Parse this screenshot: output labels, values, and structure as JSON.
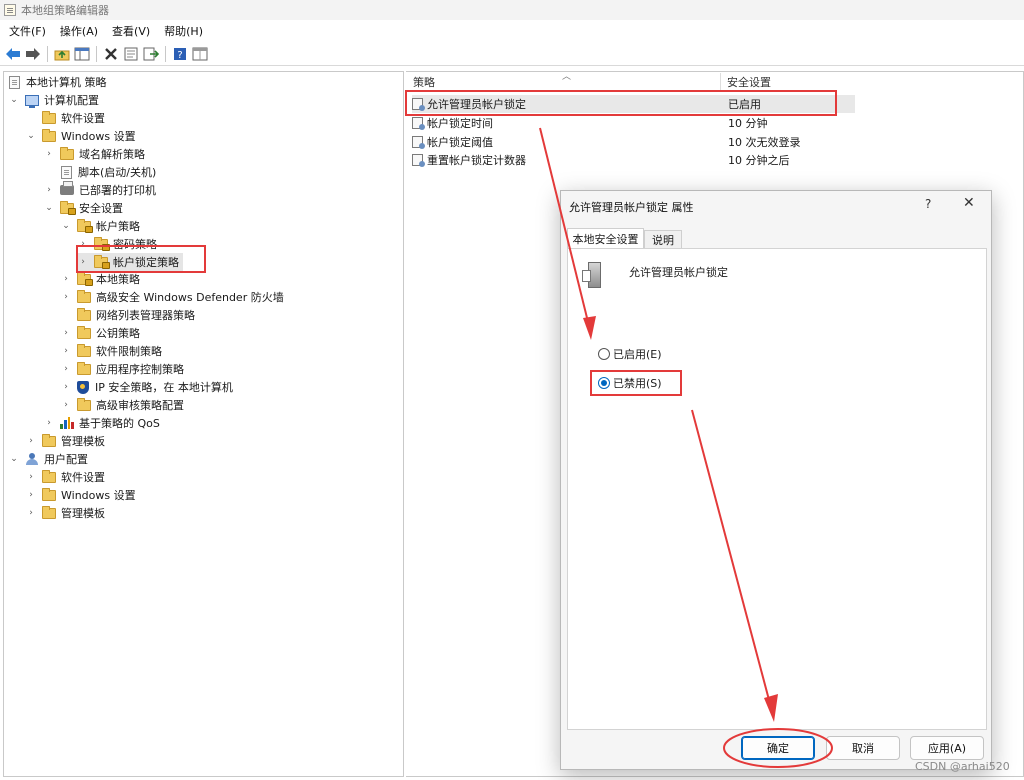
{
  "window": {
    "title": "本地组策略编辑器"
  },
  "menu": [
    "文件(F)",
    "操作(A)",
    "查看(V)",
    "帮助(H)"
  ],
  "toolbar": {
    "buttons": [
      "back-arrow-icon",
      "forward-arrow-icon",
      "up-folder-icon",
      "show-tree-icon",
      "delete-icon",
      "properties-icon",
      "export-icon",
      "help-icon",
      "view-icon"
    ]
  },
  "tree": {
    "items": [
      {
        "label": "本地计算机 策略"
      },
      {
        "label": "计算机配置"
      },
      {
        "label": "软件设置"
      },
      {
        "label": "Windows 设置"
      },
      {
        "label": "域名解析策略"
      },
      {
        "label": "脚本(启动/关机)"
      },
      {
        "label": "已部署的打印机"
      },
      {
        "label": "安全设置"
      },
      {
        "label": "帐户策略"
      },
      {
        "label": "密码策略"
      },
      {
        "label": "帐户锁定策略"
      },
      {
        "label": "本地策略"
      },
      {
        "label": "高级安全 Windows Defender 防火墙"
      },
      {
        "label": "网络列表管理器策略"
      },
      {
        "label": "公钥策略"
      },
      {
        "label": "软件限制策略"
      },
      {
        "label": "应用程序控制策略"
      },
      {
        "label": "IP 安全策略，在 本地计算机"
      },
      {
        "label": "高级审核策略配置"
      },
      {
        "label": "基于策略的 QoS"
      },
      {
        "label": "管理模板"
      },
      {
        "label": "用户配置"
      },
      {
        "label": "软件设置"
      },
      {
        "label": "Windows 设置"
      },
      {
        "label": "管理模板"
      }
    ]
  },
  "list": {
    "columns": {
      "policy": "策略",
      "setting": "安全设置"
    },
    "rows": [
      {
        "name": "允许管理员帐户锁定",
        "value": "已启用"
      },
      {
        "name": "帐户锁定时间",
        "value": "10 分钟"
      },
      {
        "name": "帐户锁定阈值",
        "value": "10 次无效登录"
      },
      {
        "name": "重置帐户锁定计数器",
        "value": "10 分钟之后"
      }
    ]
  },
  "dialog": {
    "title": "允许管理员帐户锁定 属性",
    "help": "?",
    "close": "✕",
    "tabs": [
      "本地安全设置",
      "说明"
    ],
    "policy_name": "允许管理员帐户锁定",
    "options": [
      {
        "label": "已启用(E)",
        "checked": false
      },
      {
        "label": "已禁用(S)",
        "checked": true
      }
    ],
    "buttons": {
      "ok": "确定",
      "cancel": "取消",
      "apply": "应用(A)"
    }
  },
  "watermark": "CSDN @arhai520",
  "colors": {
    "highlight": "#e33a3a",
    "accent": "#0067c0",
    "folder": "#f0c95c"
  }
}
